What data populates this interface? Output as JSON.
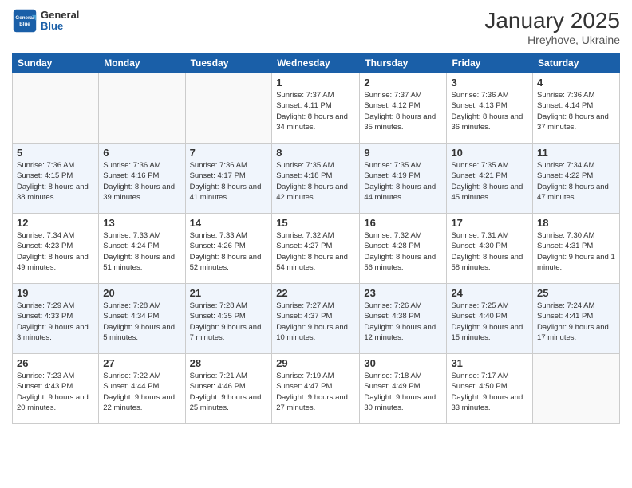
{
  "logo": {
    "general": "General",
    "blue": "Blue"
  },
  "header": {
    "month": "January 2025",
    "location": "Hreyhove, Ukraine"
  },
  "days_of_week": [
    "Sunday",
    "Monday",
    "Tuesday",
    "Wednesday",
    "Thursday",
    "Friday",
    "Saturday"
  ],
  "weeks": [
    [
      {
        "day": "",
        "sunrise": "",
        "sunset": "",
        "daylight": ""
      },
      {
        "day": "",
        "sunrise": "",
        "sunset": "",
        "daylight": ""
      },
      {
        "day": "",
        "sunrise": "",
        "sunset": "",
        "daylight": ""
      },
      {
        "day": "1",
        "sunrise": "Sunrise: 7:37 AM",
        "sunset": "Sunset: 4:11 PM",
        "daylight": "Daylight: 8 hours and 34 minutes."
      },
      {
        "day": "2",
        "sunrise": "Sunrise: 7:37 AM",
        "sunset": "Sunset: 4:12 PM",
        "daylight": "Daylight: 8 hours and 35 minutes."
      },
      {
        "day": "3",
        "sunrise": "Sunrise: 7:36 AM",
        "sunset": "Sunset: 4:13 PM",
        "daylight": "Daylight: 8 hours and 36 minutes."
      },
      {
        "day": "4",
        "sunrise": "Sunrise: 7:36 AM",
        "sunset": "Sunset: 4:14 PM",
        "daylight": "Daylight: 8 hours and 37 minutes."
      }
    ],
    [
      {
        "day": "5",
        "sunrise": "Sunrise: 7:36 AM",
        "sunset": "Sunset: 4:15 PM",
        "daylight": "Daylight: 8 hours and 38 minutes."
      },
      {
        "day": "6",
        "sunrise": "Sunrise: 7:36 AM",
        "sunset": "Sunset: 4:16 PM",
        "daylight": "Daylight: 8 hours and 39 minutes."
      },
      {
        "day": "7",
        "sunrise": "Sunrise: 7:36 AM",
        "sunset": "Sunset: 4:17 PM",
        "daylight": "Daylight: 8 hours and 41 minutes."
      },
      {
        "day": "8",
        "sunrise": "Sunrise: 7:35 AM",
        "sunset": "Sunset: 4:18 PM",
        "daylight": "Daylight: 8 hours and 42 minutes."
      },
      {
        "day": "9",
        "sunrise": "Sunrise: 7:35 AM",
        "sunset": "Sunset: 4:19 PM",
        "daylight": "Daylight: 8 hours and 44 minutes."
      },
      {
        "day": "10",
        "sunrise": "Sunrise: 7:35 AM",
        "sunset": "Sunset: 4:21 PM",
        "daylight": "Daylight: 8 hours and 45 minutes."
      },
      {
        "day": "11",
        "sunrise": "Sunrise: 7:34 AM",
        "sunset": "Sunset: 4:22 PM",
        "daylight": "Daylight: 8 hours and 47 minutes."
      }
    ],
    [
      {
        "day": "12",
        "sunrise": "Sunrise: 7:34 AM",
        "sunset": "Sunset: 4:23 PM",
        "daylight": "Daylight: 8 hours and 49 minutes."
      },
      {
        "day": "13",
        "sunrise": "Sunrise: 7:33 AM",
        "sunset": "Sunset: 4:24 PM",
        "daylight": "Daylight: 8 hours and 51 minutes."
      },
      {
        "day": "14",
        "sunrise": "Sunrise: 7:33 AM",
        "sunset": "Sunset: 4:26 PM",
        "daylight": "Daylight: 8 hours and 52 minutes."
      },
      {
        "day": "15",
        "sunrise": "Sunrise: 7:32 AM",
        "sunset": "Sunset: 4:27 PM",
        "daylight": "Daylight: 8 hours and 54 minutes."
      },
      {
        "day": "16",
        "sunrise": "Sunrise: 7:32 AM",
        "sunset": "Sunset: 4:28 PM",
        "daylight": "Daylight: 8 hours and 56 minutes."
      },
      {
        "day": "17",
        "sunrise": "Sunrise: 7:31 AM",
        "sunset": "Sunset: 4:30 PM",
        "daylight": "Daylight: 8 hours and 58 minutes."
      },
      {
        "day": "18",
        "sunrise": "Sunrise: 7:30 AM",
        "sunset": "Sunset: 4:31 PM",
        "daylight": "Daylight: 9 hours and 1 minute."
      }
    ],
    [
      {
        "day": "19",
        "sunrise": "Sunrise: 7:29 AM",
        "sunset": "Sunset: 4:33 PM",
        "daylight": "Daylight: 9 hours and 3 minutes."
      },
      {
        "day": "20",
        "sunrise": "Sunrise: 7:28 AM",
        "sunset": "Sunset: 4:34 PM",
        "daylight": "Daylight: 9 hours and 5 minutes."
      },
      {
        "day": "21",
        "sunrise": "Sunrise: 7:28 AM",
        "sunset": "Sunset: 4:35 PM",
        "daylight": "Daylight: 9 hours and 7 minutes."
      },
      {
        "day": "22",
        "sunrise": "Sunrise: 7:27 AM",
        "sunset": "Sunset: 4:37 PM",
        "daylight": "Daylight: 9 hours and 10 minutes."
      },
      {
        "day": "23",
        "sunrise": "Sunrise: 7:26 AM",
        "sunset": "Sunset: 4:38 PM",
        "daylight": "Daylight: 9 hours and 12 minutes."
      },
      {
        "day": "24",
        "sunrise": "Sunrise: 7:25 AM",
        "sunset": "Sunset: 4:40 PM",
        "daylight": "Daylight: 9 hours and 15 minutes."
      },
      {
        "day": "25",
        "sunrise": "Sunrise: 7:24 AM",
        "sunset": "Sunset: 4:41 PM",
        "daylight": "Daylight: 9 hours and 17 minutes."
      }
    ],
    [
      {
        "day": "26",
        "sunrise": "Sunrise: 7:23 AM",
        "sunset": "Sunset: 4:43 PM",
        "daylight": "Daylight: 9 hours and 20 minutes."
      },
      {
        "day": "27",
        "sunrise": "Sunrise: 7:22 AM",
        "sunset": "Sunset: 4:44 PM",
        "daylight": "Daylight: 9 hours and 22 minutes."
      },
      {
        "day": "28",
        "sunrise": "Sunrise: 7:21 AM",
        "sunset": "Sunset: 4:46 PM",
        "daylight": "Daylight: 9 hours and 25 minutes."
      },
      {
        "day": "29",
        "sunrise": "Sunrise: 7:19 AM",
        "sunset": "Sunset: 4:47 PM",
        "daylight": "Daylight: 9 hours and 27 minutes."
      },
      {
        "day": "30",
        "sunrise": "Sunrise: 7:18 AM",
        "sunset": "Sunset: 4:49 PM",
        "daylight": "Daylight: 9 hours and 30 minutes."
      },
      {
        "day": "31",
        "sunrise": "Sunrise: 7:17 AM",
        "sunset": "Sunset: 4:50 PM",
        "daylight": "Daylight: 9 hours and 33 minutes."
      },
      {
        "day": "",
        "sunrise": "",
        "sunset": "",
        "daylight": ""
      }
    ]
  ]
}
